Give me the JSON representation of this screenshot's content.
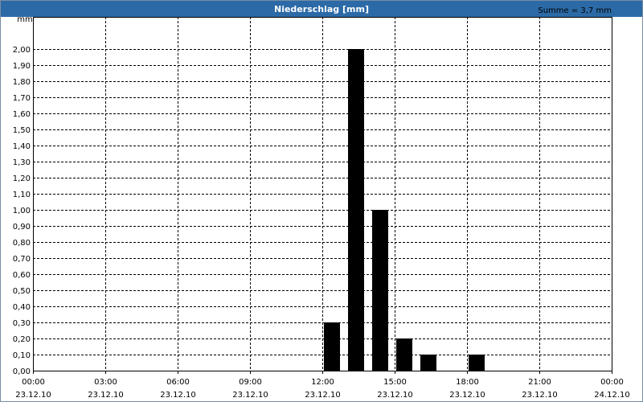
{
  "window": {
    "title": "Niederschlag [mm]",
    "accent": "#2b6aa6"
  },
  "chart_data": {
    "type": "bar",
    "title": "Niederschlag [mm]",
    "ylabel": "mm",
    "summary": "Summe = 3,7 mm",
    "bar_color": "#000000",
    "grid": true,
    "ylim": [
      0,
      2.2
    ],
    "yticks": [
      "0,00",
      "0,10",
      "0,20",
      "0,30",
      "0,40",
      "0,50",
      "0,60",
      "0,70",
      "0,80",
      "0,90",
      "1,00",
      "1,10",
      "1,20",
      "1,30",
      "1,40",
      "1,50",
      "1,60",
      "1,70",
      "1,80",
      "1,90",
      "2,00"
    ],
    "xlim_hours": [
      0,
      24
    ],
    "xticks": [
      {
        "time": "00:00",
        "date": "23.12.10"
      },
      {
        "time": "03:00",
        "date": "23.12.10"
      },
      {
        "time": "06:00",
        "date": "23.12.10"
      },
      {
        "time": "09:00",
        "date": "23.12.10"
      },
      {
        "time": "12:00",
        "date": "23.12.10"
      },
      {
        "time": "15:00",
        "date": "23.12.10"
      },
      {
        "time": "18:00",
        "date": "23.12.10"
      },
      {
        "time": "21:00",
        "date": "23.12.10"
      },
      {
        "time": "00:00",
        "date": "24.12.10"
      }
    ],
    "bars": [
      {
        "time": "12:00",
        "value": 0.3
      },
      {
        "time": "13:00",
        "value": 2.0
      },
      {
        "time": "14:00",
        "value": 1.0
      },
      {
        "time": "15:00",
        "value": 0.2
      },
      {
        "time": "16:00",
        "value": 0.1
      },
      {
        "time": "18:00",
        "value": 0.1
      }
    ]
  }
}
